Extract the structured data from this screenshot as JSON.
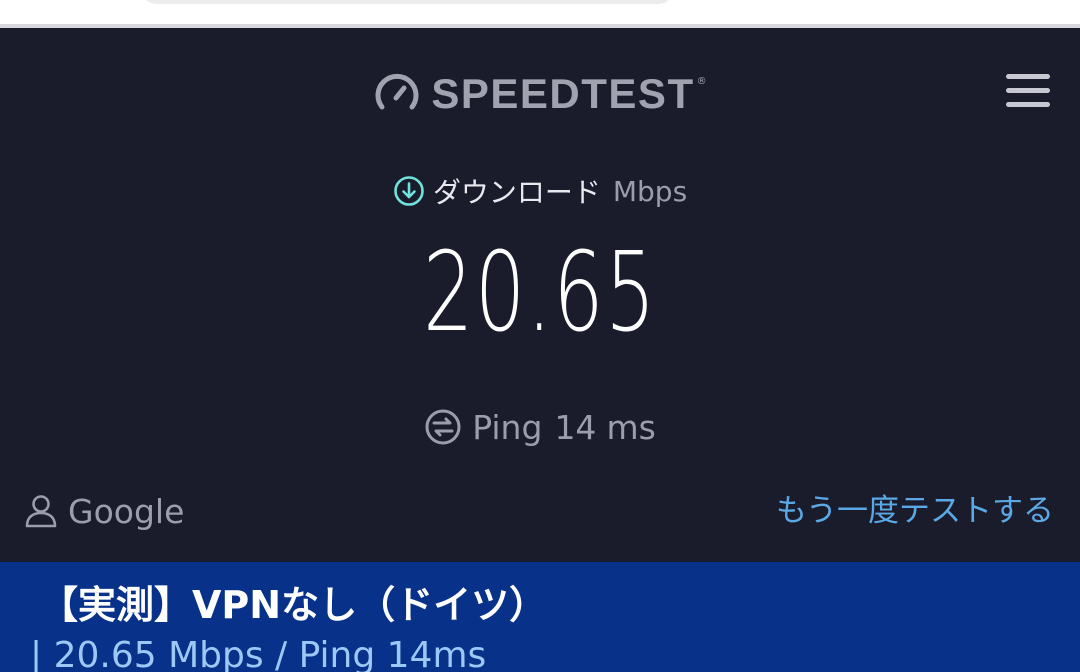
{
  "header": {
    "brand": "SPEEDTEST",
    "trademark": "®",
    "logo_icon": "speedometer-icon",
    "menu_icon": "hamburger-menu-icon"
  },
  "result": {
    "direction_icon": "download-arrow-icon",
    "direction_label": "ダウンロード",
    "unit": "Mbps",
    "value": "20.65",
    "ping_icon": "ping-icon",
    "ping_label": "Ping",
    "ping_value": "14",
    "ping_unit": "ms"
  },
  "provider": {
    "icon": "user-icon",
    "name": "Google"
  },
  "actions": {
    "retry_label": "もう一度テストする"
  },
  "caption": {
    "title": "【実測】VPNなし（ドイツ）",
    "subtitle": "| 20.65 Mbps / Ping 14ms"
  },
  "colors": {
    "background": "#1b1c2b",
    "accent_download": "#6fe3dc",
    "link": "#5aa9e6",
    "caption_bg": "#08328a",
    "caption_sub": "#9dc8f5"
  }
}
